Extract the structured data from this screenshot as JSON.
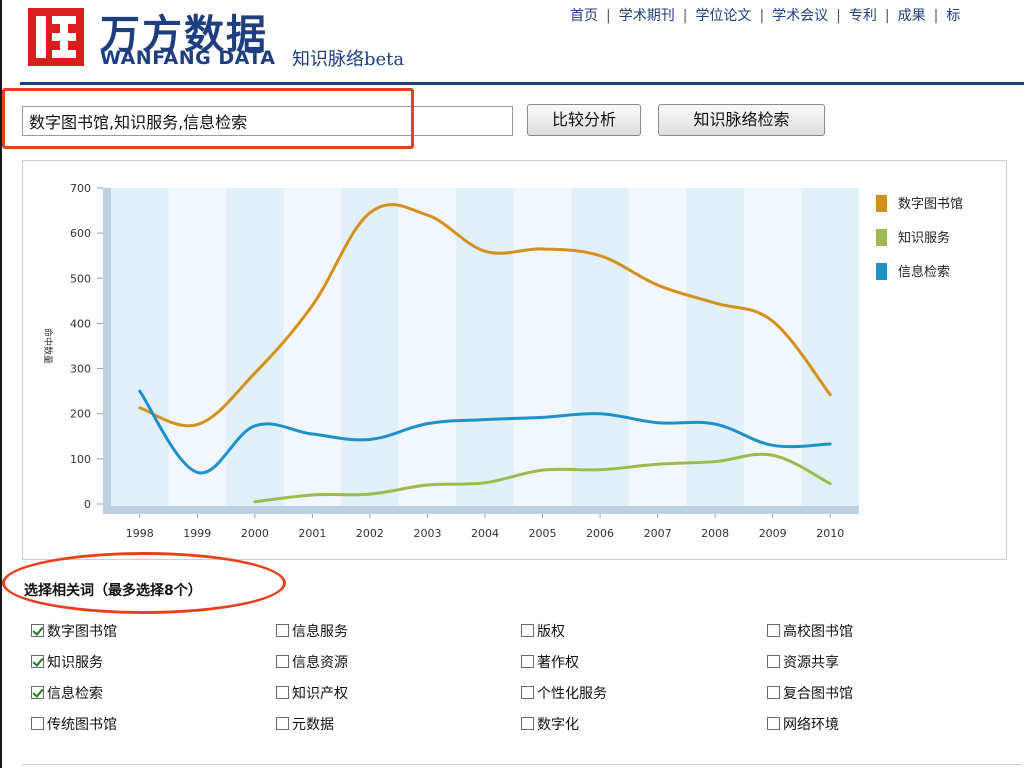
{
  "header": {
    "logo_text_cn": "万方数据",
    "logo_text_en": "WANFANG DATA",
    "logo_subtitle": "知识脉络beta",
    "nav": [
      "首页",
      "学术期刊",
      "学位论文",
      "学术会议",
      "专利",
      "成果",
      "标"
    ]
  },
  "search": {
    "value": "数字图书馆,知识服务,信息检索",
    "compare_button": "比较分析",
    "search_button": "知识脉络检索"
  },
  "chart_data": {
    "type": "line",
    "ylabel": "命中数量",
    "ylim": [
      0,
      700
    ],
    "yticks": [
      0,
      100,
      200,
      300,
      400,
      500,
      600,
      700
    ],
    "categories": [
      "1998",
      "1999",
      "2000",
      "2001",
      "2002",
      "2003",
      "2004",
      "2005",
      "2006",
      "2007",
      "2008",
      "2009",
      "2010"
    ],
    "grid": false,
    "legend": "right",
    "series": [
      {
        "name": "数字图书馆",
        "color": "#d4901e",
        "values": [
          213,
          176,
          290,
          440,
          645,
          640,
          560,
          565,
          550,
          485,
          445,
          405,
          242
        ]
      },
      {
        "name": "知识服务",
        "color": "#9cba4e",
        "values": [
          null,
          null,
          5,
          20,
          22,
          42,
          47,
          75,
          76,
          88,
          94,
          108,
          45
        ]
      },
      {
        "name": "信息检索",
        "color": "#1e90cc",
        "values": [
          250,
          70,
          173,
          155,
          143,
          178,
          187,
          192,
          200,
          180,
          177,
          130,
          133
        ]
      }
    ]
  },
  "related": {
    "title": "选择相关词（最多选择8个）",
    "columns": [
      [
        {
          "label": "数字图书馆",
          "checked": true
        },
        {
          "label": "知识服务",
          "checked": true
        },
        {
          "label": "信息检索",
          "checked": true
        },
        {
          "label": "传统图书馆",
          "checked": false
        }
      ],
      [
        {
          "label": "信息服务",
          "checked": false
        },
        {
          "label": "信息资源",
          "checked": false
        },
        {
          "label": "知识产权",
          "checked": false
        },
        {
          "label": "元数据",
          "checked": false
        }
      ],
      [
        {
          "label": "版权",
          "checked": false
        },
        {
          "label": "著作权",
          "checked": false
        },
        {
          "label": "个性化服务",
          "checked": false
        },
        {
          "label": "数字化",
          "checked": false
        }
      ],
      [
        {
          "label": "高校图书馆",
          "checked": false
        },
        {
          "label": "资源共享",
          "checked": false
        },
        {
          "label": "复合图书馆",
          "checked": false
        },
        {
          "label": "网络环境",
          "checked": false
        }
      ]
    ]
  }
}
